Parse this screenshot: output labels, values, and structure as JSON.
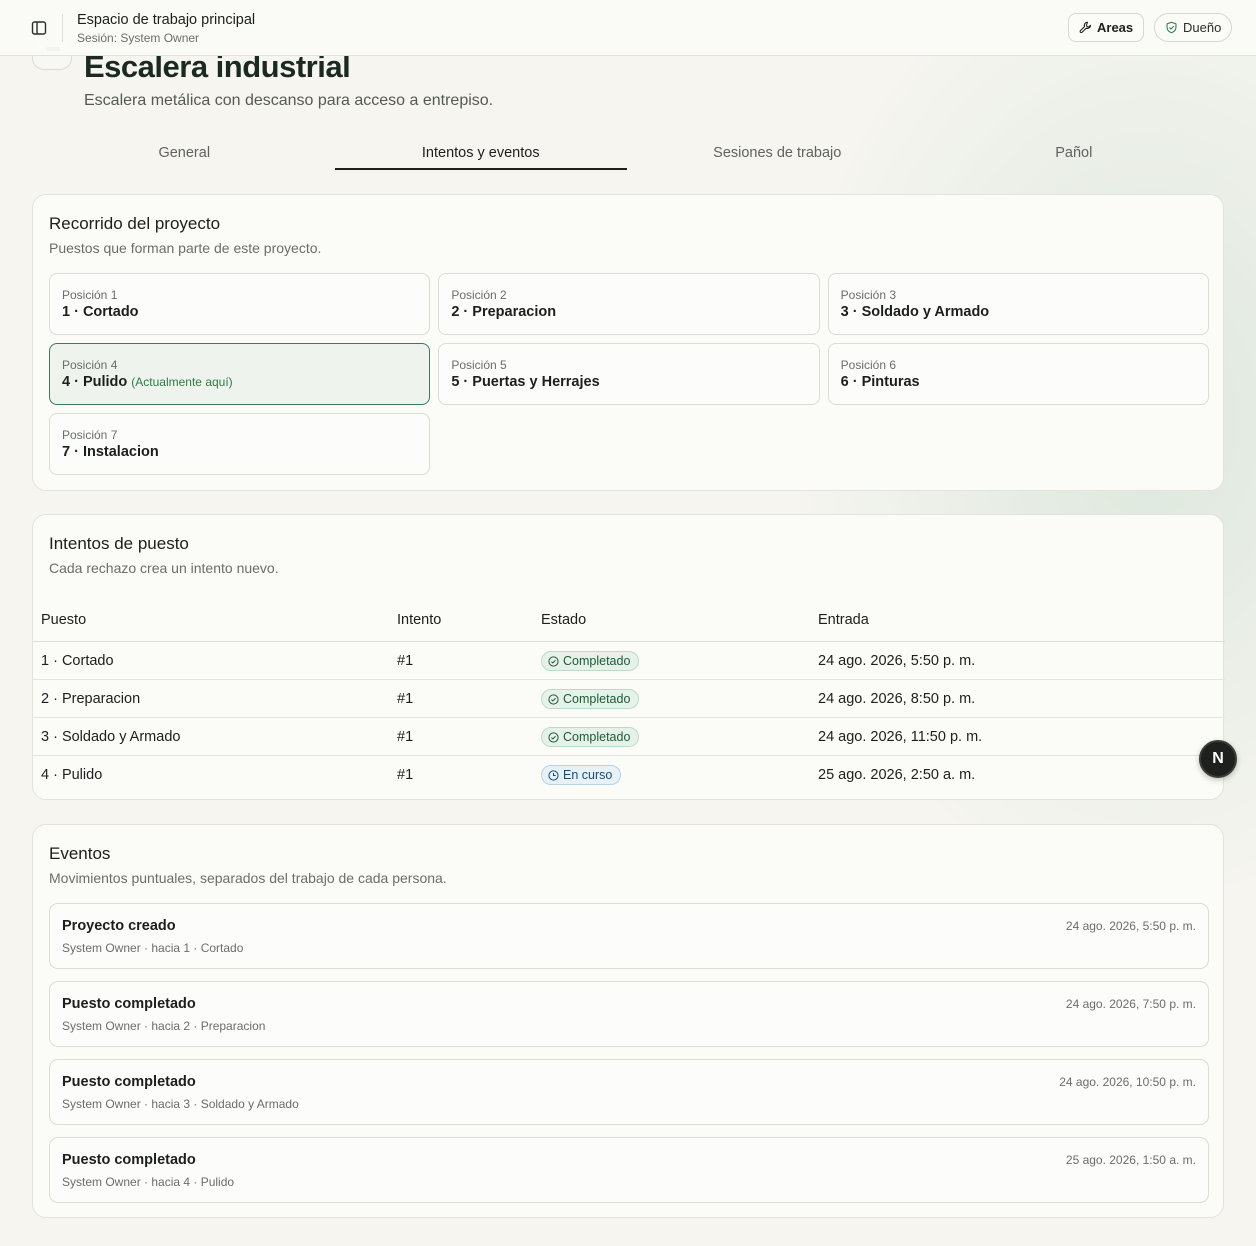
{
  "topbar": {
    "workspace_title": "Espacio de trabajo principal",
    "session": "Sesión: System Owner",
    "areas_label": "Areas",
    "owner_label": "Dueño"
  },
  "project": {
    "title": "Escalera industrial",
    "description": "Escalera metálica con descanso para acceso a entrepiso."
  },
  "tabs": [
    {
      "label": "General"
    },
    {
      "label": "Intentos y eventos",
      "active": true
    },
    {
      "label": "Sesiones de trabajo"
    },
    {
      "label": "Pañol"
    }
  ],
  "route": {
    "title": "Recorrido del proyecto",
    "subtitle": "Puestos que forman parte de este proyecto.",
    "positions": [
      {
        "label": "Posición 1",
        "name": "1 · Cortado"
      },
      {
        "label": "Posición 2",
        "name": "2 · Preparacion"
      },
      {
        "label": "Posición 3",
        "name": "3 · Soldado y Armado"
      },
      {
        "label": "Posición 4",
        "name": "4 · Pulido",
        "here": "(Actualmente aquí)"
      },
      {
        "label": "Posición 5",
        "name": "5 · Puertas y Herrajes"
      },
      {
        "label": "Posición 6",
        "name": "6 · Pinturas"
      },
      {
        "label": "Posición 7",
        "name": "7 · Instalacion"
      }
    ]
  },
  "attempts": {
    "title": "Intentos de puesto",
    "subtitle": "Cada rechazo crea un intento nuevo.",
    "headers": [
      "Puesto",
      "Intento",
      "Estado",
      "Entrada"
    ],
    "rows": [
      {
        "station": "1 · Cortado",
        "attempt": "#1",
        "status": "Completado",
        "entry": "24 ago. 2026, 5:50 p. m."
      },
      {
        "station": "2 · Preparacion",
        "attempt": "#1",
        "status": "Completado",
        "entry": "24 ago. 2026, 8:50 p. m."
      },
      {
        "station": "3 · Soldado y Armado",
        "attempt": "#1",
        "status": "Completado",
        "entry": "24 ago. 2026, 11:50 p. m."
      },
      {
        "station": "4 · Pulido",
        "attempt": "#1",
        "status": "En curso",
        "entry": "25 ago. 2026, 2:50 a. m."
      }
    ]
  },
  "events": {
    "title": "Eventos",
    "subtitle": "Movimientos puntuales, separados del trabajo de cada persona.",
    "items": [
      {
        "title": "Proyecto creado",
        "meta": "System Owner · hacia 1 · Cortado",
        "time": "24 ago. 2026, 5:50 p. m."
      },
      {
        "title": "Puesto completado",
        "meta": "System Owner · hacia 2 · Preparacion",
        "time": "24 ago. 2026, 7:50 p. m."
      },
      {
        "title": "Puesto completado",
        "meta": "System Owner · hacia 3 · Soldado y Armado",
        "time": "24 ago. 2026, 10:50 p. m."
      },
      {
        "title": "Puesto completado",
        "meta": "System Owner · hacia 4 · Pulido",
        "time": "25 ago. 2026, 1:50 a. m."
      }
    ]
  },
  "fab_label": "N",
  "colors": {
    "accent_green": "#2f7a47",
    "done_badge": "#e6f2e9",
    "progress_badge": "#e7f1f8"
  }
}
